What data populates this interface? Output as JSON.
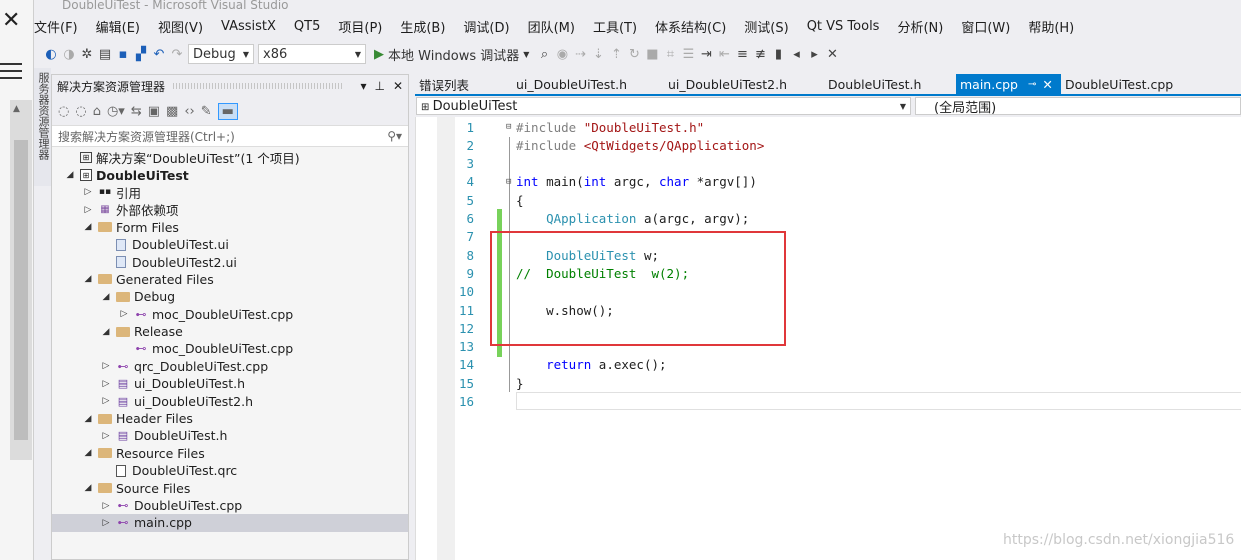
{
  "window_title": "DoubleUiTest - Microsoft Visual Studio",
  "menu": [
    "文件(F)",
    "编辑(E)",
    "视图(V)",
    "VAssistX",
    "QT5",
    "项目(P)",
    "生成(B)",
    "调试(D)",
    "团队(M)",
    "工具(T)",
    "体系结构(C)",
    "测试(S)",
    "Qt VS Tools",
    "分析(N)",
    "窗口(W)",
    "帮助(H)"
  ],
  "toolbar": {
    "config": "Debug",
    "platform": "x86",
    "debugger": "本地 Windows 调试器"
  },
  "solution_explorer": {
    "title": "解决方案资源管理器",
    "search_placeholder": "搜索解决方案资源管理器(Ctrl+;)",
    "vertical_tab": "服务器资源管理器",
    "rows": [
      {
        "depth": 0,
        "tri": "",
        "icon": "sol",
        "label": "解决方案“DoubleUiTest”(1 个项目)"
      },
      {
        "depth": 0,
        "tri": "◢",
        "icon": "proj",
        "label": "DoubleUiTest",
        "bold": true
      },
      {
        "depth": 1,
        "tri": "▷",
        "icon": "ref",
        "label": "引用"
      },
      {
        "depth": 1,
        "tri": "▷",
        "icon": "dep",
        "label": "外部依赖项"
      },
      {
        "depth": 1,
        "tri": "◢",
        "icon": "folder",
        "label": "Form Files"
      },
      {
        "depth": 2,
        "tri": "",
        "icon": "ui",
        "label": "DoubleUiTest.ui"
      },
      {
        "depth": 2,
        "tri": "",
        "icon": "ui",
        "label": "DoubleUiTest2.ui"
      },
      {
        "depth": 1,
        "tri": "◢",
        "icon": "folder",
        "label": "Generated Files"
      },
      {
        "depth": 2,
        "tri": "◢",
        "icon": "folder",
        "label": "Debug"
      },
      {
        "depth": 3,
        "tri": "▷",
        "icon": "cpp",
        "label": "moc_DoubleUiTest.cpp"
      },
      {
        "depth": 2,
        "tri": "◢",
        "icon": "folder",
        "label": "Release"
      },
      {
        "depth": 3,
        "tri": "",
        "icon": "cpp",
        "label": "moc_DoubleUiTest.cpp"
      },
      {
        "depth": 2,
        "tri": "▷",
        "icon": "cpp",
        "label": "qrc_DoubleUiTest.cpp"
      },
      {
        "depth": 2,
        "tri": "▷",
        "icon": "hdr",
        "label": "ui_DoubleUiTest.h"
      },
      {
        "depth": 2,
        "tri": "▷",
        "icon": "hdr",
        "label": "ui_DoubleUiTest2.h"
      },
      {
        "depth": 1,
        "tri": "◢",
        "icon": "folder",
        "label": "Header Files"
      },
      {
        "depth": 2,
        "tri": "▷",
        "icon": "hdr",
        "label": "DoubleUiTest.h"
      },
      {
        "depth": 1,
        "tri": "◢",
        "icon": "folder",
        "label": "Resource Files"
      },
      {
        "depth": 2,
        "tri": "",
        "icon": "file",
        "label": "DoubleUiTest.qrc"
      },
      {
        "depth": 1,
        "tri": "◢",
        "icon": "folder",
        "label": "Source Files"
      },
      {
        "depth": 2,
        "tri": "▷",
        "icon": "cpp",
        "label": "DoubleUiTest.cpp"
      },
      {
        "depth": 2,
        "tri": "▷",
        "icon": "cpp",
        "label": "main.cpp",
        "selected": true
      }
    ]
  },
  "tabs": [
    {
      "label": "错误列表"
    },
    {
      "label": "ui_DoubleUiTest.h"
    },
    {
      "label": "ui_DoubleUiTest2.h"
    },
    {
      "label": "DoubleUiTest.h"
    },
    {
      "label": "main.cpp",
      "active": true
    },
    {
      "label": "DoubleUiTest.cpp"
    }
  ],
  "nav": {
    "scope": "DoubleUiTest",
    "member": "(全局范围)"
  },
  "code_lines": [
    {
      "n": "1",
      "html": "<span class=\"pp\">#include </span><span class=\"str\">\"DoubleUiTest.h\"</span>"
    },
    {
      "n": "2",
      "html": "<span class=\"pp\">#include </span><span class=\"str\">&lt;QtWidgets/QApplication&gt;</span>"
    },
    {
      "n": "3",
      "html": ""
    },
    {
      "n": "4",
      "html": "<span class=\"kw\">int</span> main(<span class=\"kw\">int</span> argc, <span class=\"kw\">char</span> *argv[])"
    },
    {
      "n": "5",
      "html": "{"
    },
    {
      "n": "6",
      "html": "    <span class=\"cls\">QApplication</span> a(argc, argv);"
    },
    {
      "n": "7",
      "html": ""
    },
    {
      "n": "8",
      "html": "    <span class=\"cls\">DoubleUiTest</span> w;"
    },
    {
      "n": "9",
      "html": "<span class=\"cm\">//  DoubleUiTest  w(2);</span>"
    },
    {
      "n": "10",
      "html": ""
    },
    {
      "n": "11",
      "html": "    w.show();"
    },
    {
      "n": "12",
      "html": ""
    },
    {
      "n": "13",
      "html": ""
    },
    {
      "n": "14",
      "html": "    <span class=\"kw\">return</span> a.exec();"
    },
    {
      "n": "15",
      "html": "}"
    },
    {
      "n": "16",
      "html": ""
    }
  ],
  "watermark": "https://blog.csdn.net/xiongjia516"
}
